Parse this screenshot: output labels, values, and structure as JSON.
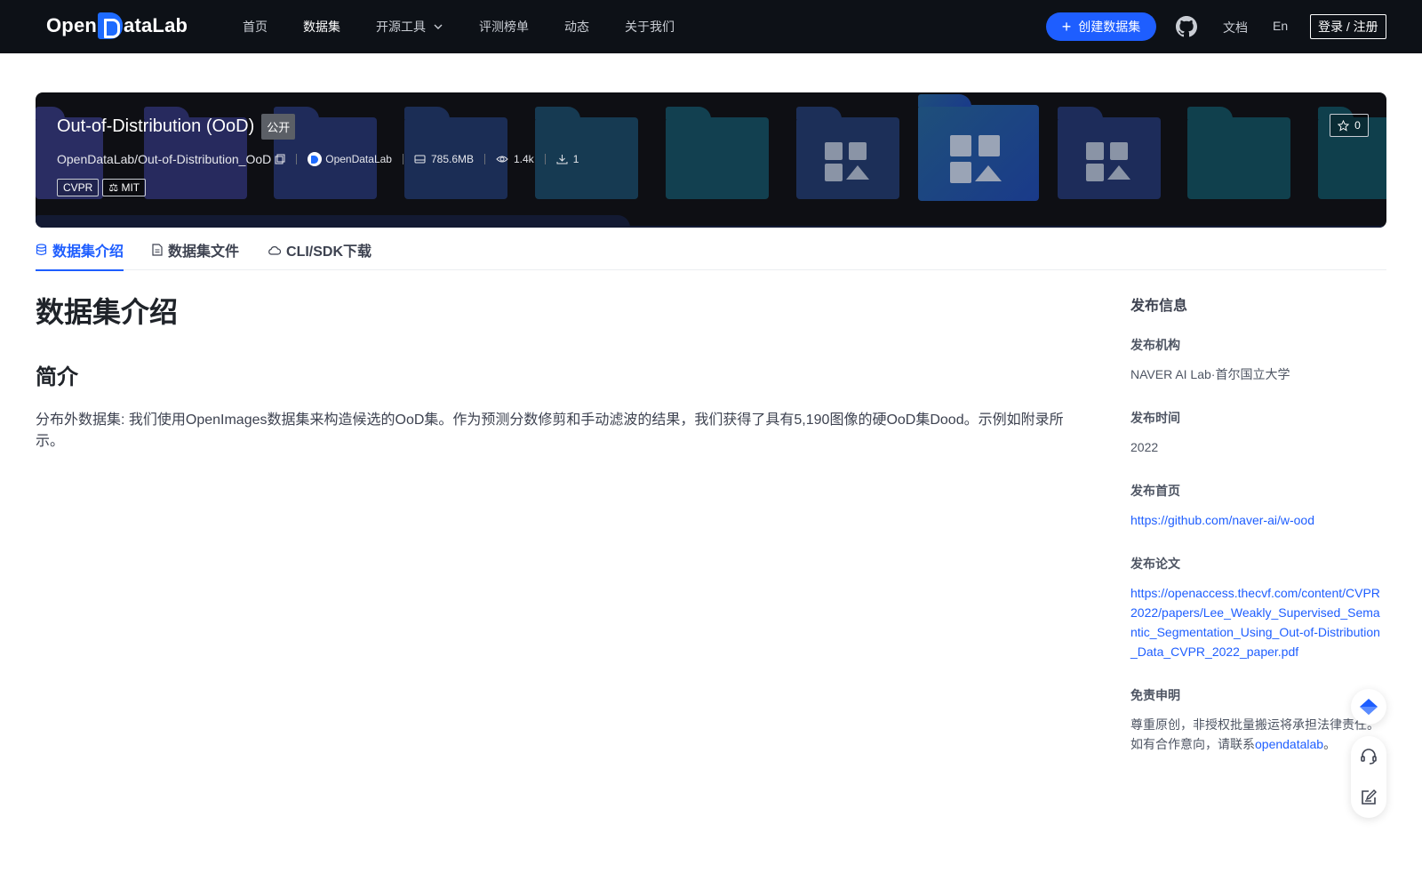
{
  "nav": {
    "logo_text_left": "Open",
    "logo_text_right": "ataLab",
    "links": [
      "首页",
      "数据集",
      "开源工具",
      "评测榜单",
      "动态",
      "关于我们"
    ],
    "active_link": "数据集",
    "create_button": "创建数据集",
    "docs": "文档",
    "language": "En",
    "login": "登录 / 注册"
  },
  "dataset": {
    "title": "Out-of-Distribution (OoD)",
    "visibility": "公开",
    "path": "OpenDataLab/Out-of-Distribution_OoD",
    "org": "OpenDataLab",
    "size": "785.6MB",
    "views": "1.4k",
    "downloads": "1",
    "tags": [
      "CVPR",
      "MIT"
    ],
    "stars": "0"
  },
  "tabs": [
    "数据集介绍",
    "数据集文件",
    "CLI/SDK下载"
  ],
  "active_tab": "数据集介绍",
  "content": {
    "heading": "数据集介绍",
    "subheading": "简介",
    "paragraph": "分布外数据集: 我们使用OpenImages数据集来构造候选的OoD集。作为预测分数修剪和手动滤波的结果，我们获得了具有5,190图像的硬OoD集Dood。示例如附录所示。"
  },
  "sidebar": {
    "title": "发布信息",
    "org_label": "发布机构",
    "org_value": "NAVER AI Lab·首尔国立大学",
    "time_label": "发布时间",
    "time_value": "2022",
    "homepage_label": "发布首页",
    "homepage_value": "https://github.com/naver-ai/w-ood",
    "paper_label": "发布论文",
    "paper_value": "https://openaccess.thecvf.com/content/CVPR2022/papers/Lee_Weakly_Supervised_Semantic_Segmentation_Using_Out-of-Distribution_Data_CVPR_2022_paper.pdf",
    "disclaimer_label": "免责申明",
    "disclaimer_text": "尊重原创，非授权批量搬运将承担法律责任。如有合作意向，请联系",
    "disclaimer_link": "opendatalab",
    "disclaimer_end": "。"
  },
  "colors": {
    "nav_bg": "#0d1117",
    "accent": "#1e5eff",
    "banner_bg": "#0e0f14"
  },
  "icons": [
    "github-icon",
    "star-icon",
    "database-icon",
    "file-icon",
    "cloud-icon",
    "disk-icon",
    "eye-icon",
    "download-icon",
    "copy-icon",
    "scale-icon",
    "diamond-icon",
    "headset-icon",
    "edit-icon"
  ]
}
